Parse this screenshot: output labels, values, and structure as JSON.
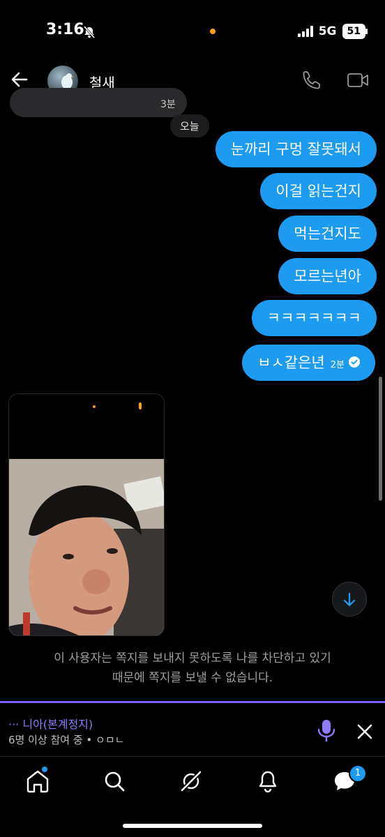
{
  "status_bar": {
    "time": "3:16",
    "network": "5G",
    "battery": "51"
  },
  "header": {
    "contact_name": "철새"
  },
  "conversation": {
    "partial_received_time": "3분",
    "date_separator": "오늘",
    "sent_messages": [
      {
        "text": "눈까리 구멍 잘못돼서"
      },
      {
        "text": "이걸 읽는건지"
      },
      {
        "text": "먹는건지도"
      },
      {
        "text": "모르는년아"
      },
      {
        "text": "ㅋㅋㅋㅋㅋㅋㅋ"
      },
      {
        "text": "ㅂㅅ같은년",
        "time": "2분"
      }
    ],
    "blocked_notice_line1": "이 사용자는 쪽지를 보내지 못하도록 나를 차단하고 있기",
    "blocked_notice_line2": "때문에 쪽지를 보낼 수 없습니다."
  },
  "space_bar": {
    "title": "··· 니아(본계정지)",
    "subtitle": "6명 이상 참여 중 • ㅇㅁㄴ"
  },
  "bottom_nav": {
    "items": [
      "home-icon",
      "search-icon",
      "grok-icon",
      "notifications-icon",
      "messages-icon"
    ],
    "messages_badge": "1"
  },
  "colors": {
    "accent": "#1d9bf0",
    "space_purple": "#7b5cff",
    "background": "#000000"
  }
}
